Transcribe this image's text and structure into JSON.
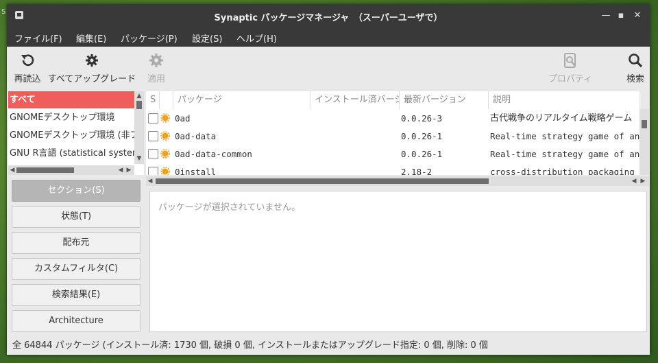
{
  "window": {
    "title": "Synaptic パッケージマネージャ　（スーパーユーザで）",
    "minimize": "—",
    "maximize": "▪",
    "close": "✕"
  },
  "menu": [
    "ファイル(F)",
    "編集(E)",
    "パッケージ(P)",
    "設定(S)",
    "ヘルプ(H)"
  ],
  "toolbar": {
    "reload": "再読込",
    "upgrade_all": "すべてアップグレード",
    "apply": "適用",
    "properties": "プロパティ",
    "search": "検索"
  },
  "filters": [
    "すべて",
    "GNOMEデスクトップ環境",
    "GNOMEデスクトップ環境 (非フリー)",
    "GNU R言語 (statistical system)"
  ],
  "side_buttons": {
    "section": "セクション(S)",
    "status": "状態(T)",
    "origin": "配布元",
    "custom": "カスタムフィルタ(C)",
    "search_results": "検索結果(E)",
    "architecture": "Architecture"
  },
  "table": {
    "headers": {
      "s": "S",
      "package": "パッケージ",
      "installed": "インストール済バージョン",
      "latest": "最新バージョン",
      "description": "説明"
    },
    "rows": [
      {
        "name": "0ad",
        "installed": "",
        "latest": "0.0.26-3",
        "description": "古代戦争のリアルタイム戦略ゲーム"
      },
      {
        "name": "0ad-data",
        "installed": "",
        "latest": "0.0.26-1",
        "description": "Real-time strategy game of ancient warfare"
      },
      {
        "name": "0ad-data-common",
        "installed": "",
        "latest": "0.0.26-1",
        "description": "Real-time strategy game of ancient warfare"
      },
      {
        "name": "0install",
        "installed": "",
        "latest": "2.18-2",
        "description": "cross-distribution packaging system"
      }
    ]
  },
  "details": {
    "message": "パッケージが選択されていません。"
  },
  "status": "全 64844 パッケージ (インストール済: 1730 個, 破損 0 個, インストールまたはアップグレード指定: 0 個, 削除: 0 個",
  "colors": {
    "selected_filter": "#f05d5d",
    "titlebar": "#393939",
    "package_icon": "#f0a020"
  }
}
